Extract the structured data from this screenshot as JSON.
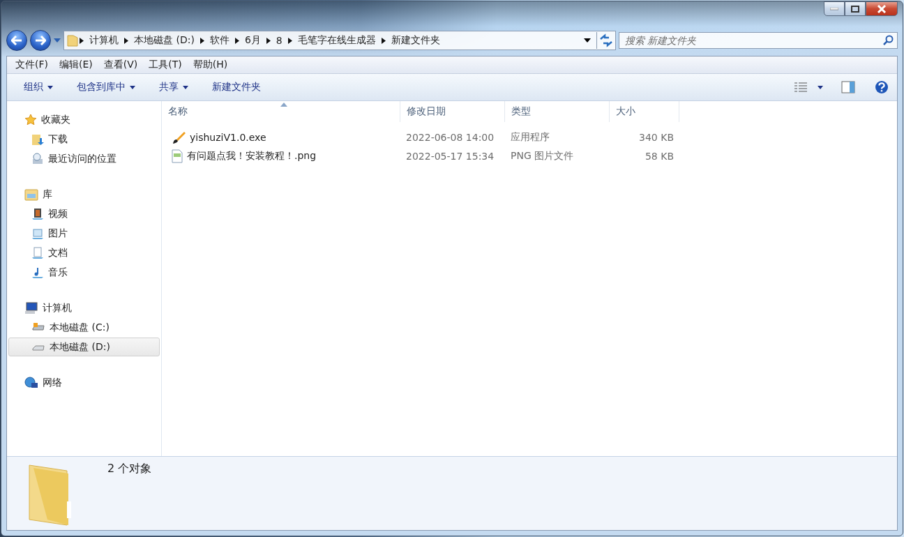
{
  "breadcrumb": [
    "计算机",
    "本地磁盘 (D:)",
    "软件",
    "6月",
    "8",
    "毛笔字在线生成器",
    "新建文件夹"
  ],
  "search": {
    "placeholder": "搜索 新建文件夹"
  },
  "menu": [
    "文件(F)",
    "编辑(E)",
    "查看(V)",
    "工具(T)",
    "帮助(H)"
  ],
  "toolbar": [
    {
      "label": "组织",
      "dropdown": true
    },
    {
      "label": "包含到库中",
      "dropdown": true
    },
    {
      "label": "共享",
      "dropdown": true
    },
    {
      "label": "新建文件夹",
      "dropdown": false
    }
  ],
  "sidebar": [
    {
      "label": "收藏夹",
      "kind": "star",
      "selected": false,
      "children": [
        {
          "label": "下载",
          "kind": "download",
          "selected": false
        },
        {
          "label": "最近访问的位置",
          "kind": "recent",
          "selected": false
        }
      ]
    },
    {
      "label": "库",
      "kind": "library",
      "selected": false,
      "children": [
        {
          "label": "视频",
          "kind": "video",
          "selected": false
        },
        {
          "label": "图片",
          "kind": "picture",
          "selected": false
        },
        {
          "label": "文档",
          "kind": "document",
          "selected": false
        },
        {
          "label": "音乐",
          "kind": "music",
          "selected": false
        }
      ]
    },
    {
      "label": "计算机",
      "kind": "computer",
      "selected": false,
      "children": [
        {
          "label": "本地磁盘 (C:)",
          "kind": "system",
          "selected": false
        },
        {
          "label": "本地磁盘 (D:)",
          "kind": "drive",
          "selected": true
        }
      ]
    },
    {
      "label": "网络",
      "kind": "network",
      "selected": false
    }
  ],
  "table": {
    "columns": [
      {
        "label": "名称",
        "sorted": true
      },
      {
        "label": "修改日期",
        "sorted": false
      },
      {
        "label": "类型",
        "sorted": false
      },
      {
        "label": "大小",
        "sorted": false
      }
    ],
    "rows": [
      {
        "kind": "exe",
        "name": "yishuziV1.0.exe",
        "date": "2022-06-08 14:00",
        "type": "应用程序",
        "size": "340 KB"
      },
      {
        "kind": "png",
        "name": "有问题点我！安装教程！.png",
        "date": "2022-05-17 15:34",
        "type": "PNG 图片文件",
        "size": "58 KB"
      }
    ]
  },
  "status_bar": {
    "count": "2 个对象"
  }
}
